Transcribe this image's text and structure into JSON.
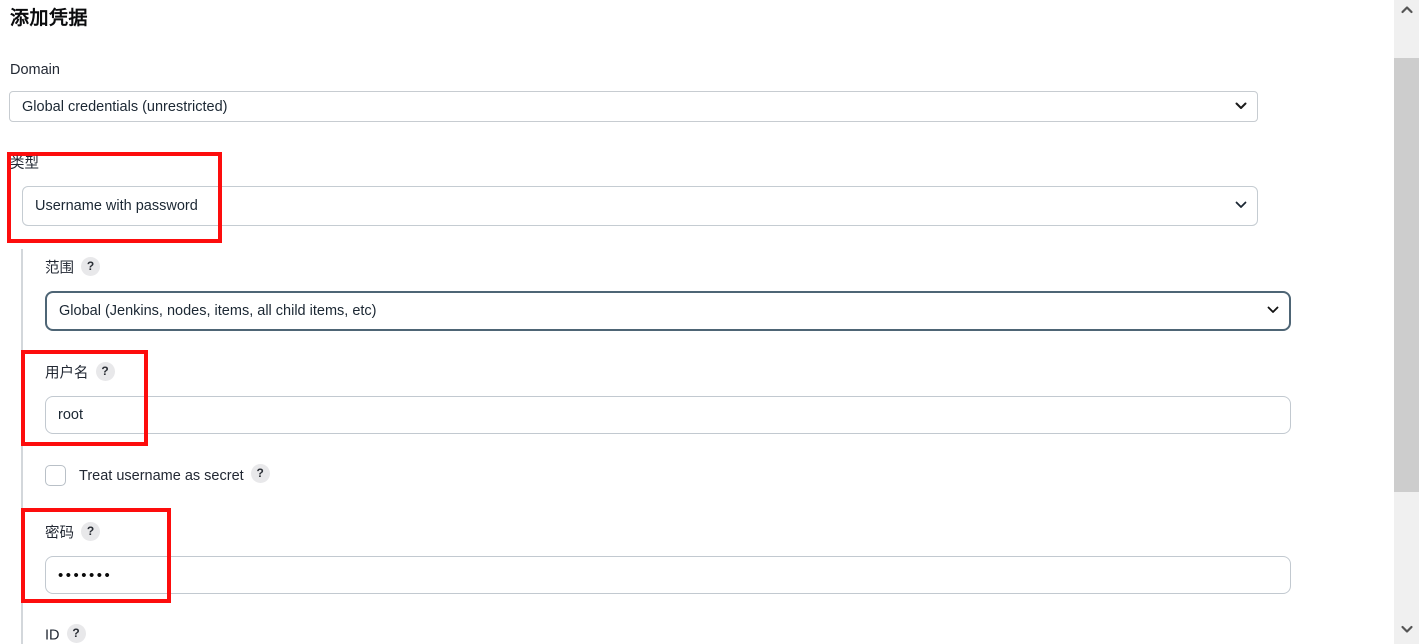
{
  "page": {
    "title": "添加凭据"
  },
  "domain": {
    "label": "Domain",
    "value": "Global credentials (unrestricted)"
  },
  "type": {
    "label": "类型",
    "value": "Username with password"
  },
  "scope": {
    "label": "范围",
    "help": "?",
    "value": "Global (Jenkins, nodes, items, all child items, etc)"
  },
  "username": {
    "label": "用户名",
    "help": "?",
    "value": "root"
  },
  "treat_secret": {
    "label": "Treat username as secret",
    "help": "?",
    "checked": false
  },
  "password": {
    "label": "密码",
    "help": "?",
    "masked_value": "•••••••"
  },
  "id": {
    "label": "ID",
    "help": "?"
  },
  "annotations": {
    "color": "#fd0d0d",
    "boxes": [
      {
        "target": "type-field"
      },
      {
        "target": "username-field"
      },
      {
        "target": "password-field"
      }
    ]
  },
  "scrollbar": {
    "up_icon": "chevron-up-icon",
    "down_icon": "chevron-down-icon",
    "thumb_color": "#cdcdcd",
    "track_color": "#f0f0f0"
  }
}
